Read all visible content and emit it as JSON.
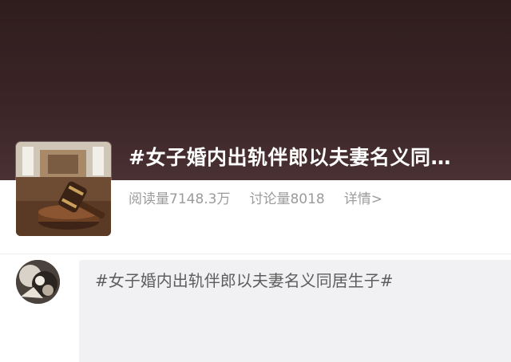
{
  "topic": {
    "title": "#女子婚内出轨伴郎以夫妻名义同…",
    "thumbnail_icon": "judge-gavel-courtroom-image",
    "stats": {
      "reads": "阅读量7148.3万",
      "discussions": "讨论量8018",
      "details_link": "详情>"
    }
  },
  "composer": {
    "avatar_icon": "user-avatar-image",
    "text": "#女子婚内出轨伴郎以夫妻名义同居生子#"
  },
  "colors": {
    "banner": "#3a2426",
    "title_text": "#ffffff",
    "stats_text": "#9b9b9b",
    "composer_bg": "#f1f1f3"
  }
}
